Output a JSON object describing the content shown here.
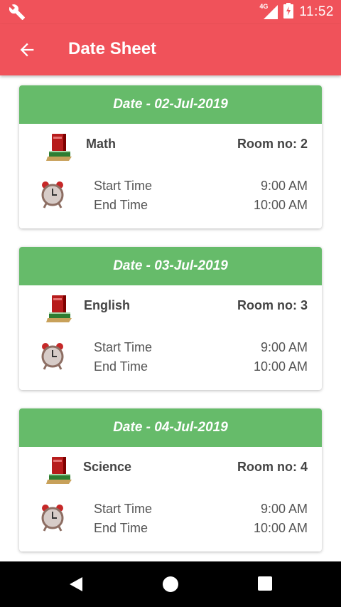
{
  "status_bar": {
    "network": "4G",
    "time": "11:52"
  },
  "app_bar": {
    "title": "Date Sheet"
  },
  "exams": [
    {
      "date": "Date - 02-Jul-2019",
      "subject": "Math",
      "room": "Room no: 2",
      "start_label": "Start Time",
      "start_time": "9:00 AM",
      "end_label": "End Time",
      "end_time": "10:00 AM"
    },
    {
      "date": "Date - 03-Jul-2019",
      "subject": "English",
      "room": "Room no: 3",
      "start_label": "Start Time",
      "start_time": "9:00 AM",
      "end_label": "End Time",
      "end_time": "10:00 AM"
    },
    {
      "date": "Date - 04-Jul-2019",
      "subject": "Science",
      "room": "Room no: 4",
      "start_label": "Start Time",
      "start_time": "9:00 AM",
      "end_label": "End Time",
      "end_time": "10:00 AM"
    }
  ],
  "colors": {
    "primary": "#f0525a",
    "card_header": "#66bb6a"
  }
}
